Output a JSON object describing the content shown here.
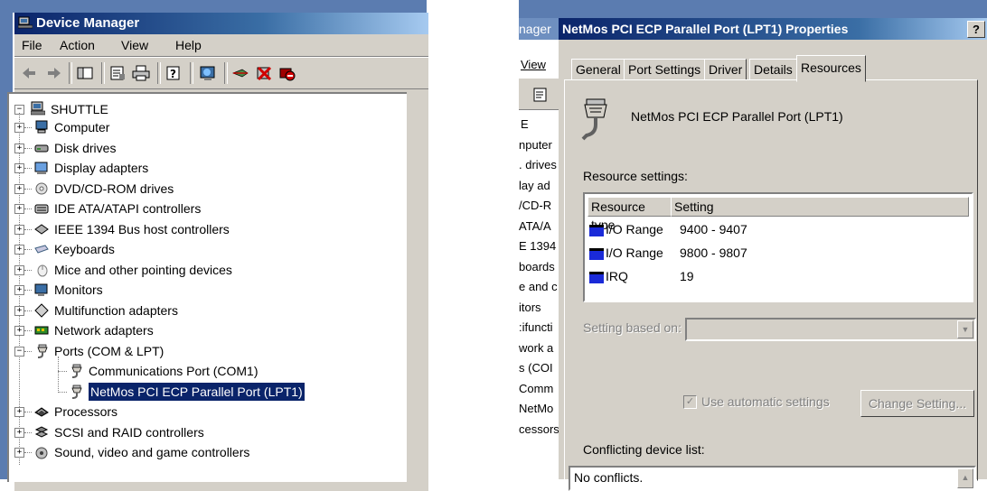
{
  "colors": {
    "title_active": "#0a246a",
    "window_face": "#d4d0c8",
    "chip_blue": "#1a2ad8"
  },
  "device_manager": {
    "title": "Device Manager",
    "menu": [
      "File",
      "Action",
      "View",
      "Help"
    ],
    "toolbar_icons": [
      "back-icon",
      "forward-icon",
      "console-tree-icon",
      "properties-icon",
      "print-icon",
      "help-icon",
      "scan-hardware-icon",
      "update-driver-icon",
      "uninstall-icon",
      "disable-icon"
    ],
    "tree": {
      "root": "SHUTTLE",
      "items": [
        {
          "label": "Computer",
          "icon": "computer-icon"
        },
        {
          "label": "Disk drives",
          "icon": "disk-drive-icon"
        },
        {
          "label": "Display adapters",
          "icon": "display-adapter-icon"
        },
        {
          "label": "DVD/CD-ROM drives",
          "icon": "dvd-drive-icon"
        },
        {
          "label": "IDE ATA/ATAPI controllers",
          "icon": "ide-controller-icon"
        },
        {
          "label": "IEEE 1394 Bus host controllers",
          "icon": "ieee1394-icon"
        },
        {
          "label": "Keyboards",
          "icon": "keyboard-icon"
        },
        {
          "label": "Mice and other pointing devices",
          "icon": "mouse-icon"
        },
        {
          "label": "Monitors",
          "icon": "monitor-icon"
        },
        {
          "label": "Multifunction adapters",
          "icon": "multifunction-icon"
        },
        {
          "label": "Network adapters",
          "icon": "network-adapter-icon"
        },
        {
          "label": "Ports (COM & LPT)",
          "icon": "port-icon"
        },
        {
          "label": "Communications Port (COM1)",
          "icon": "port-icon"
        },
        {
          "label": "NetMos PCI ECP Parallel Port (LPT1)",
          "icon": "port-icon"
        },
        {
          "label": "Processors",
          "icon": "processor-icon"
        },
        {
          "label": "SCSI and RAID controllers",
          "icon": "scsi-icon"
        },
        {
          "label": "Sound, video and game controllers",
          "icon": "sound-icon"
        }
      ]
    }
  },
  "background_window": {
    "title_fragment": "nager",
    "menu_fragment": "View",
    "tree_fragments": [
      "E",
      "nputer",
      ". drives",
      "lay ad",
      "/CD-R",
      "ATA/A",
      "E 1394",
      "boards",
      "e and c",
      "itors",
      ":ifuncti",
      "work a",
      "s (COI",
      "Comm",
      "NetMo",
      "cessors"
    ]
  },
  "properties": {
    "title": "NetMos PCI ECP Parallel Port (LPT1) Properties",
    "help_button": "?",
    "tabs": [
      "General",
      "Port Settings",
      "Driver",
      "Details",
      "Resources"
    ],
    "active_tab": "Resources",
    "device_name": "NetMos PCI ECP Parallel Port (LPT1)",
    "resource_settings_label": "Resource settings:",
    "columns": [
      "Resource type",
      "Setting"
    ],
    "resources": [
      {
        "type": "I/O Range",
        "setting": "9400 - 9407"
      },
      {
        "type": "I/O Range",
        "setting": "9800 - 9807"
      },
      {
        "type": "IRQ",
        "setting": "19"
      }
    ],
    "setting_based_on_label": "Setting based on:",
    "use_automatic_label": "Use automatic settings",
    "use_automatic_checked": true,
    "change_setting_label": "Change Setting...",
    "conflicting_label": "Conflicting device list:",
    "conflicting_value": "No conflicts."
  }
}
